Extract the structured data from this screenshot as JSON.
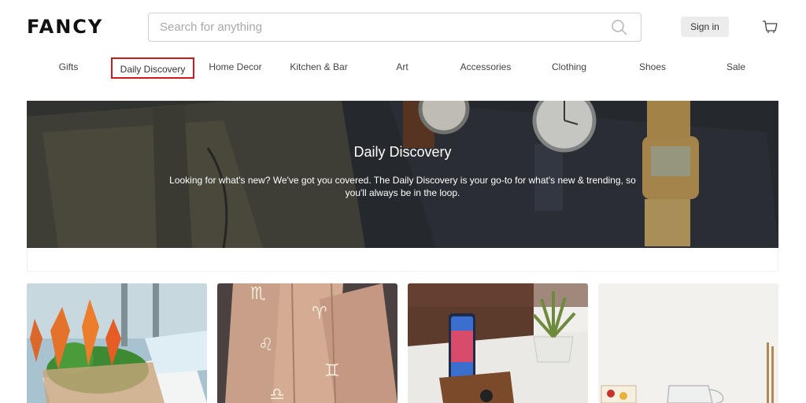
{
  "header": {
    "logo": "FANCY",
    "search_placeholder": "Search for anything",
    "signin_label": "Sign in"
  },
  "nav": {
    "items": [
      {
        "label": "Gifts"
      },
      {
        "label": "Daily Discovery",
        "active": true
      },
      {
        "label": "Home Decor"
      },
      {
        "label": "Kitchen & Bar"
      },
      {
        "label": "Art"
      },
      {
        "label": "Accessories"
      },
      {
        "label": "Clothing"
      },
      {
        "label": "Shoes"
      },
      {
        "label": "Sale"
      }
    ]
  },
  "hero": {
    "title": "Daily Discovery",
    "description": "Looking for what's new? We've got you covered. The Daily Discovery is your go-to for what's new & trending, so you'll always be in the loop."
  },
  "colors": {
    "active_outline": "#d0191c",
    "signin_bg": "#ececec"
  },
  "icons": [
    "search-icon",
    "cart-icon"
  ]
}
